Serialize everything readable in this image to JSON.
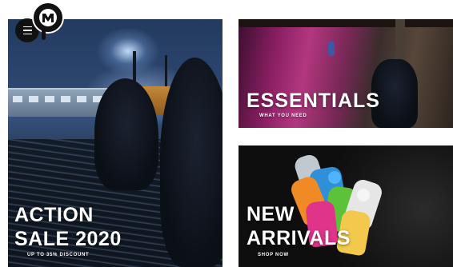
{
  "header": {
    "menu_icon": "hamburger-menu-icon",
    "logo_icon": "brand-logo-icon",
    "logo_letter": "M"
  },
  "tiles": {
    "action": {
      "title_line1": "ACTION",
      "title_line2": "SALE 2020",
      "subtitle": "UP TO 35% DISCOUNT"
    },
    "essentials": {
      "title": "ESSENTIALS",
      "subtitle": "WHAT YOU NEED"
    },
    "arrivals": {
      "title_line1": "NEW",
      "title_line2": "ARRIVALS",
      "subtitle": "SHOP NOW"
    }
  },
  "colors": {
    "text": "#ffffff",
    "logo_bg": "#111111",
    "page_bg": "#ffffff"
  }
}
